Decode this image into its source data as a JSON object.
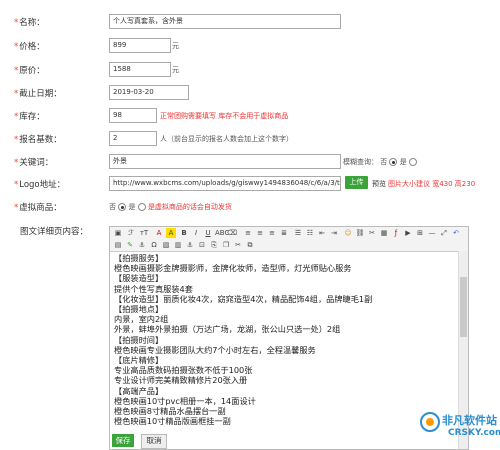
{
  "fields": {
    "name": {
      "label": "名称：",
      "value": "个人写真套系，含外景"
    },
    "price": {
      "label": "价格：",
      "value": "899",
      "unit": "元"
    },
    "orig": {
      "label": "原价：",
      "value": "1588",
      "unit": "元"
    },
    "deadline": {
      "label": "截止日期：",
      "value": "2019-03-20"
    },
    "stock": {
      "label": "库存：",
      "value": "98",
      "note": "正常团购需要填写 库存不会用于虚拟商品"
    },
    "signup": {
      "label": "报名基数：",
      "value": "2",
      "unit": "人（前台显示的报名人数会加上这个数字）"
    },
    "keyword": {
      "label": "关键词：",
      "value": "外景",
      "fuzzy_label": "模糊查询：",
      "yes": "否",
      "no": "是"
    },
    "logo": {
      "label": "Logo地址：",
      "value": "http://www.wxbcms.com/uploads/g/giswwy1494836048/c/6/a/3/thumb_",
      "upload": "上传",
      "preview": "预览",
      "hint": "图片大小建议 宽430 高230"
    },
    "virtual": {
      "label": "虚拟商品：",
      "no": "否",
      "yes": "是",
      "note": "是虚拟商品的话会自动发货"
    },
    "detail": {
      "label": "图文详细页内容："
    }
  },
  "editor": {
    "lines": [
      "【拍摄服务】",
      "橙色映画摄影金牌摄影师，金牌化妆师，造型师，灯光师贴心服务",
      "【服装造型】",
      "提供个性写真服装4套",
      "【化妆造型】丽质化妆4次，窈窕造型4次，精品配饰4组，品牌睫毛1副",
      "【拍摄地点】",
      "内景，室内2组",
      "外景，蚌埠外景拍摄（万达广场，龙湖，张公山只选一处）2组",
      "【拍摄时间】",
      "橙色映画专业摄影团队大约7个小时左右，全程温馨服务",
      "【底片精修】",
      "专业高品质数码拍摄张数不低于100张",
      "专业设计师完美精致精修片20张入册",
      "【高端产品】",
      "橙色映画10寸pvc相册一本，14面设计",
      "橙色映画8寸精品水晶摆台一副",
      "橙色映画10寸精品版画框挂一副"
    ]
  },
  "buttons": {
    "save": "保存",
    "cancel": "取消"
  },
  "watermark": {
    "title": "非凡软件站",
    "sub": "CRSKY.com"
  }
}
